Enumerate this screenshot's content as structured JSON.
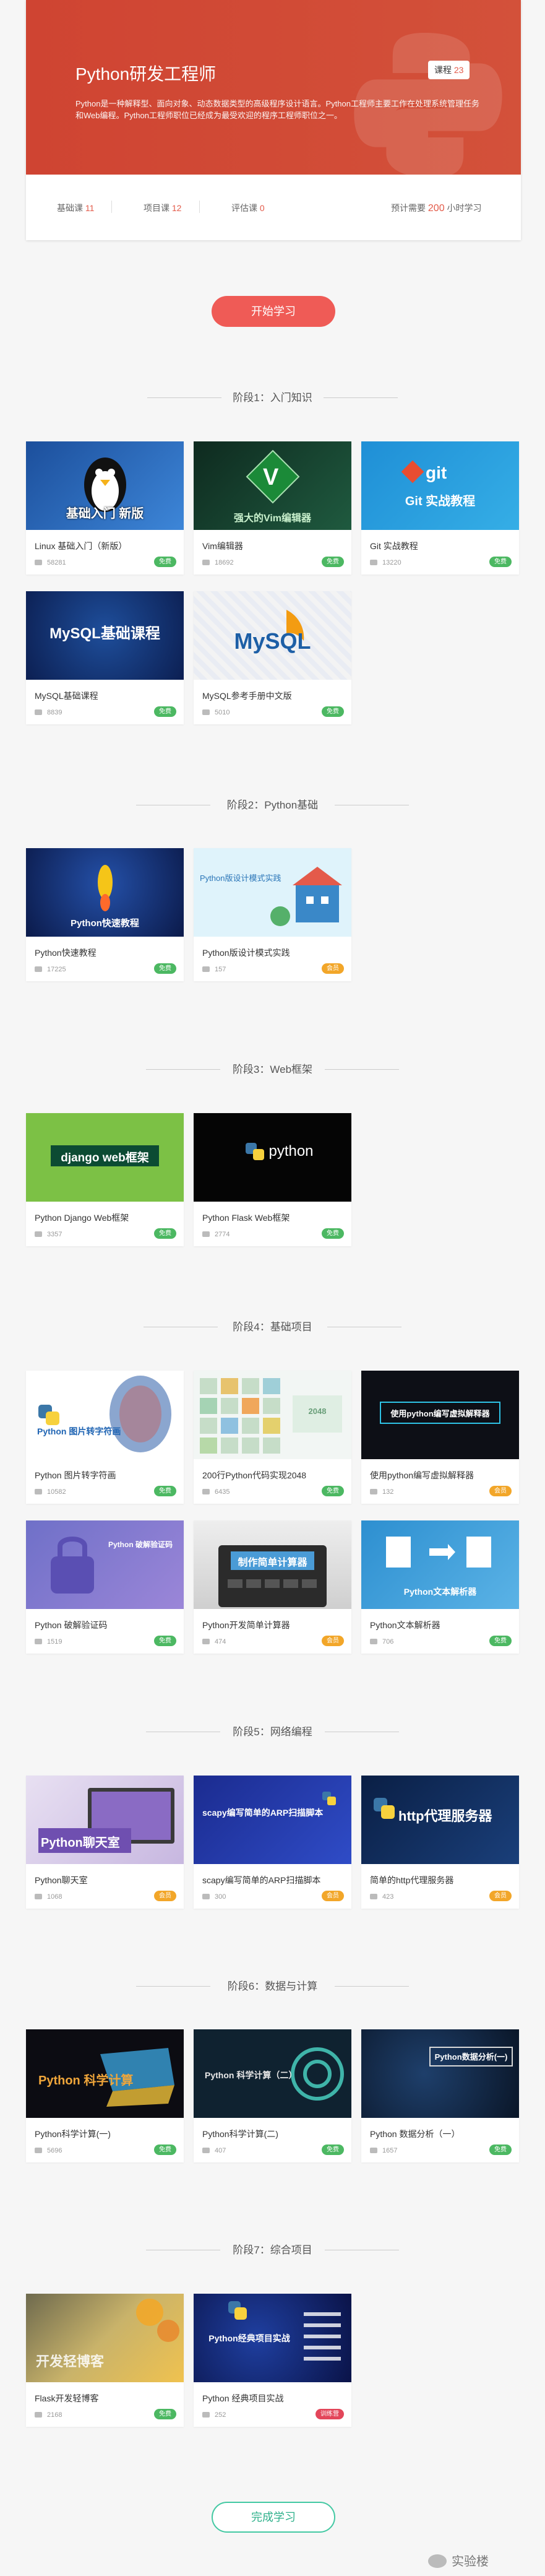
{
  "hero": {
    "title": "Python研发工程师",
    "badge_label": "课程",
    "badge_count": "23",
    "description": "Python是一种解释型、面向对象、动态数据类型的高级程序设计语言。Python工程师主要工作在处理系统管理任务和Web编程。Python工程师职位已经成为最受欢迎的程序工程师职位之一。",
    "stats": {
      "basic_label": "基础课",
      "basic_count": "11",
      "project_label": "项目课",
      "project_count": "12",
      "eval_label": "评估课",
      "eval_count": "0",
      "estimate_prefix": "预计需要",
      "estimate_hours": "200",
      "estimate_suffix": "小时学习"
    }
  },
  "start_button": "开始学习",
  "finish_button": "完成学习",
  "watermark": "实验楼",
  "stages": [
    {
      "title": "阶段1：入门知识",
      "courses": [
        {
          "name": "Linux 基础入门（新版）",
          "count": "58281",
          "tag": "免费",
          "thumb_text": "基础入门 新版"
        },
        {
          "name": "Vim编辑器",
          "count": "18692",
          "tag": "免费",
          "thumb_text": "强大的Vim编辑器"
        },
        {
          "name": "Git 实战教程",
          "count": "13220",
          "tag": "免费",
          "thumb_text": "Git 实战教程"
        },
        {
          "name": "MySQL基础课程",
          "count": "8839",
          "tag": "免费",
          "thumb_text": "MySQL基础课程"
        },
        {
          "name": "MySQL参考手册中文版",
          "count": "5010",
          "tag": "免费",
          "thumb_text": "MySQL"
        }
      ]
    },
    {
      "title": "阶段2：Python基础",
      "courses": [
        {
          "name": "Python快速教程",
          "count": "17225",
          "tag": "免费",
          "thumb_text": "Python快速教程"
        },
        {
          "name": "Python版设计模式实践",
          "count": "157",
          "tag": "会员",
          "thumb_text": "Python版设计模式实践"
        }
      ]
    },
    {
      "title": "阶段3：Web框架",
      "courses": [
        {
          "name": "Python Django Web框架",
          "count": "3357",
          "tag": "免费",
          "thumb_text": "django web框架"
        },
        {
          "name": "Python Flask Web框架",
          "count": "2774",
          "tag": "免费",
          "thumb_text": "python"
        }
      ]
    },
    {
      "title": "阶段4：基础项目",
      "courses": [
        {
          "name": "Python 图片转字符画",
          "count": "10582",
          "tag": "免费",
          "thumb_text": "Python 图片转字符画"
        },
        {
          "name": "200行Python代码实现2048",
          "count": "6435",
          "tag": "免费",
          "thumb_text": "2048"
        },
        {
          "name": "使用python编写虚拟解释器",
          "count": "132",
          "tag": "会员",
          "thumb_text": "使用python编写虚拟解释器"
        },
        {
          "name": "Python 破解验证码",
          "count": "1519",
          "tag": "免费",
          "thumb_text": "Python 破解验证码"
        },
        {
          "name": "Python开发简单计算器",
          "count": "474",
          "tag": "会员",
          "thumb_text": "制作简单计算器"
        },
        {
          "name": "Python文本解析器",
          "count": "706",
          "tag": "免费",
          "thumb_text": "Python文本解析器"
        }
      ]
    },
    {
      "title": "阶段5：网络编程",
      "courses": [
        {
          "name": "Python聊天室",
          "count": "1068",
          "tag": "会员",
          "thumb_text": "Python聊天室"
        },
        {
          "name": "scapy编写简单的ARP扫描脚本",
          "count": "300",
          "tag": "会员",
          "thumb_text": "scapy编写简单的ARP扫描脚本"
        },
        {
          "name": "简单的http代理服务器",
          "count": "423",
          "tag": "会员",
          "thumb_text": "http代理服务器"
        }
      ]
    },
    {
      "title": "阶段6：数据与计算",
      "courses": [
        {
          "name": "Python科学计算(一)",
          "count": "5696",
          "tag": "免费",
          "thumb_text": "Python 科学计算"
        },
        {
          "name": "Python科学计算(二)",
          "count": "407",
          "tag": "免费",
          "thumb_text": "Python 科学计算（二）"
        },
        {
          "name": "Python 数据分析（一）",
          "count": "1657",
          "tag": "免费",
          "thumb_text": "Python数据分析(一)"
        }
      ]
    },
    {
      "title": "阶段7：综合项目",
      "courses": [
        {
          "name": "Flask开发轻博客",
          "count": "2168",
          "tag": "免费",
          "thumb_text": "开发轻博客"
        },
        {
          "name": "Python 经典项目实战",
          "count": "252",
          "tag": "训练营",
          "thumb_text": "Python经典项目实战"
        }
      ]
    }
  ]
}
